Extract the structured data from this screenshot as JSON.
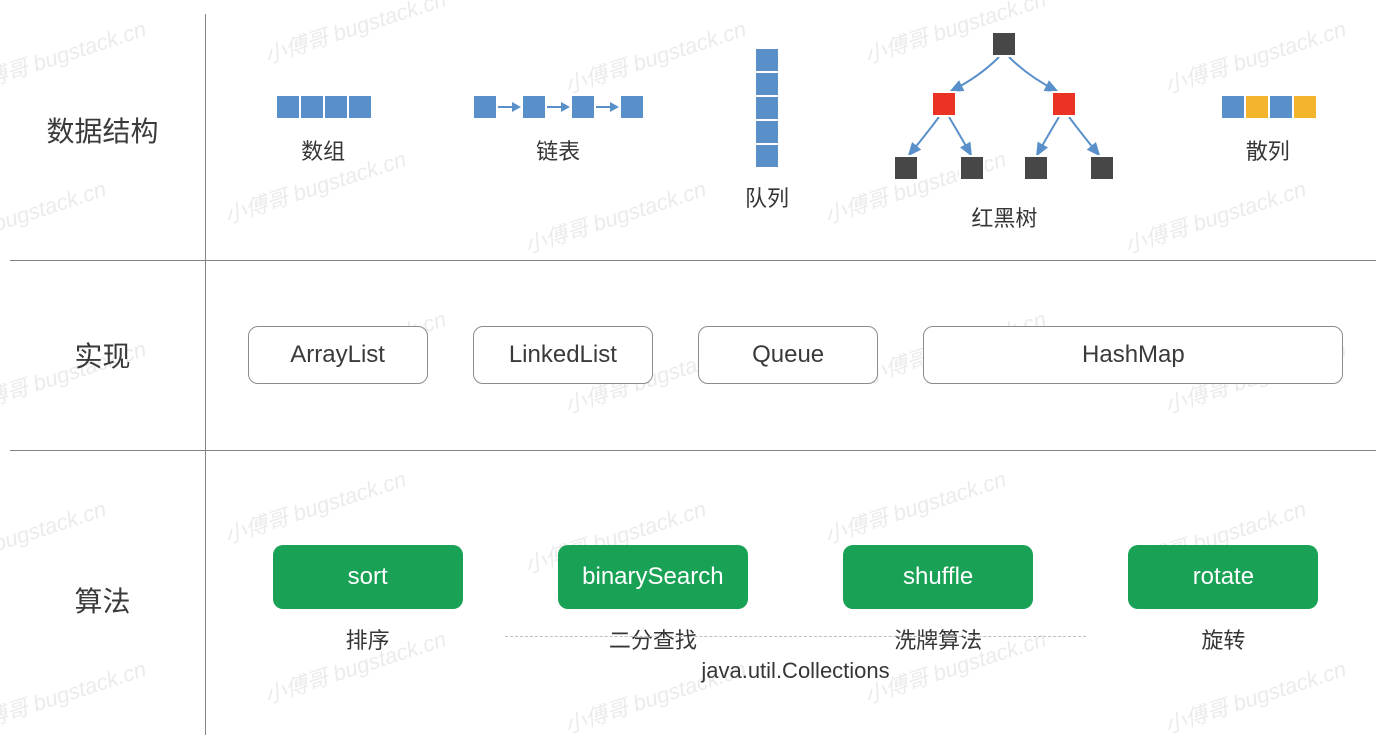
{
  "watermark": "小傅哥 bugstack.cn",
  "rows": {
    "structures": {
      "label": "数据结构",
      "items": {
        "array": {
          "label": "数组"
        },
        "linked": {
          "label": "链表"
        },
        "queue": {
          "label": "队列"
        },
        "rbtree": {
          "label": "红黑树"
        },
        "hash": {
          "label": "散列"
        }
      }
    },
    "impl": {
      "label": "实现",
      "items": {
        "arraylist": "ArrayList",
        "linkedlist": "LinkedList",
        "queue": "Queue",
        "hashmap": "HashMap"
      }
    },
    "algo": {
      "label": "算法",
      "items": {
        "sort": {
          "name": "sort",
          "sub": "排序"
        },
        "bsearch": {
          "name": "binarySearch",
          "sub": "二分查找"
        },
        "shuffle": {
          "name": "shuffle",
          "sub": "洗牌算法"
        },
        "rotate": {
          "name": "rotate",
          "sub": "旋转"
        }
      },
      "footer": "java.util.Collections"
    }
  },
  "colors": {
    "blue": "#5990ca",
    "red": "#ea3323",
    "dark": "#474747",
    "orange": "#f4b52e",
    "green": "#19a155"
  }
}
